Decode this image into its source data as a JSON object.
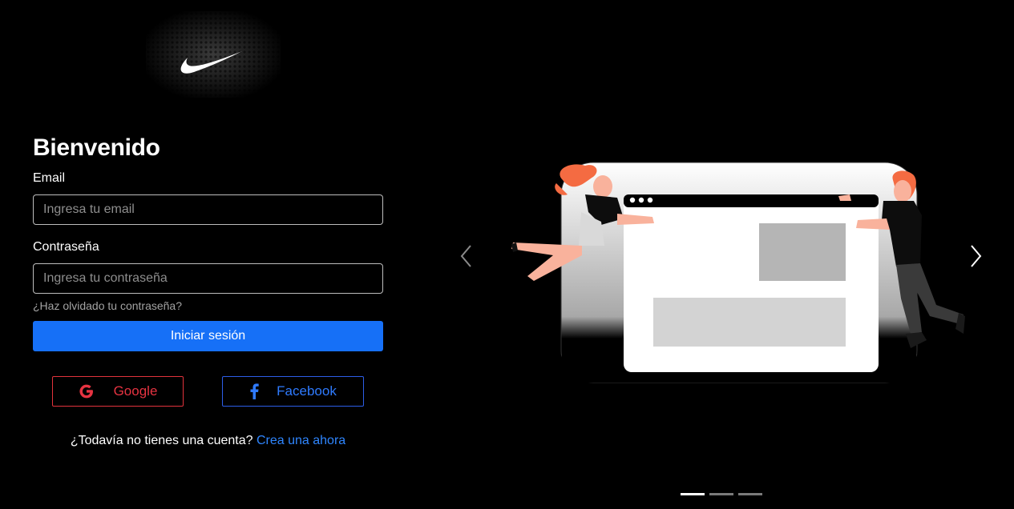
{
  "brand": {
    "logo_icon": "nike-swoosh-icon"
  },
  "login": {
    "title": "Bienvenido",
    "email_label": "Email",
    "email_placeholder": "Ingresa tu email",
    "password_label": "Contraseña",
    "password_placeholder": "Ingresa tu contraseña",
    "forgot_link": "¿Haz olvidado tu contraseña?",
    "submit_label": "Iniciar sesión"
  },
  "social": {
    "google": {
      "label": "Google",
      "icon": "google-icon",
      "color": "#e63341"
    },
    "facebook": {
      "label": "Facebook",
      "icon": "facebook-icon",
      "color": "#2f7bff"
    }
  },
  "signup": {
    "prompt": "¿Todavía no tienes una cuenta?",
    "link": "Crea una ahora"
  },
  "carousel": {
    "prev_icon": "chevron-left-icon",
    "next_icon": "chevron-right-icon",
    "slide_count": 3,
    "active_index": 0
  },
  "colors": {
    "background": "#000000",
    "primary": "#1670f7",
    "link": "#2f86ff"
  }
}
